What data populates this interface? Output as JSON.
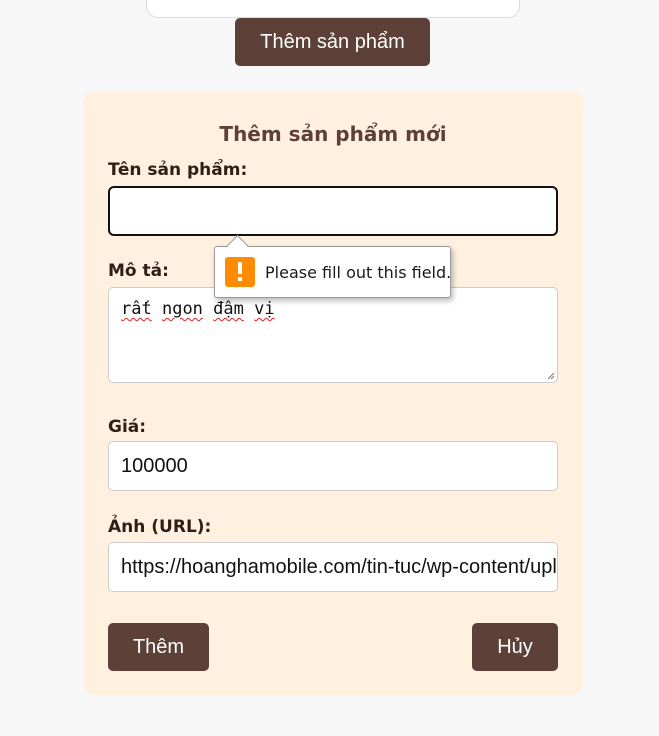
{
  "header": {
    "add_product_button": "Thêm sản phẩm"
  },
  "form": {
    "title": "Thêm sản phẩm mới",
    "name": {
      "label": "Tên sản phẩm:",
      "value": ""
    },
    "description": {
      "label": "Mô tả:",
      "words": [
        "rất",
        "ngon",
        "đậm",
        "vị"
      ]
    },
    "price": {
      "label": "Giá:",
      "value": "100000"
    },
    "image_url": {
      "label": "Ảnh (URL):",
      "value": "https://hoanghamobile.com/tin-tuc/wp-content/uploads/"
    },
    "submit_button": "Thêm",
    "cancel_button": "Hủy"
  },
  "validation_tooltip": {
    "message": "Please fill out this field.",
    "icon": "warning-icon"
  },
  "colors": {
    "button_brown": "#5d4037",
    "panel_bg": "#fff0df",
    "page_bg": "#f7f7f7",
    "warning_orange": "#ff8c00"
  }
}
